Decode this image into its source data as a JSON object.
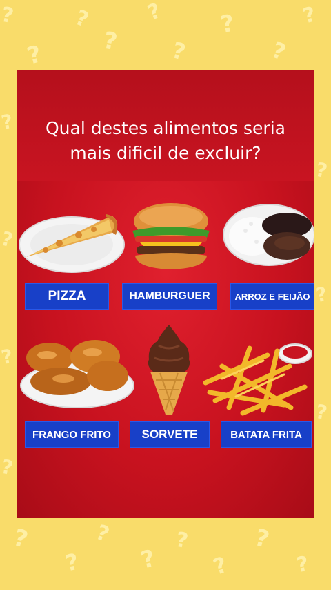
{
  "question": {
    "line1": "Qual destes alimentos seria",
    "line2": "mais dificil de excluir?"
  },
  "options": [
    {
      "label": "PIZZA",
      "icon": "pizza-icon"
    },
    {
      "label": "HAMBURGUER",
      "icon": "hamburger-icon"
    },
    {
      "label": "ARROZ E FEIJÃO",
      "icon": "rice-beans-icon"
    },
    {
      "label": "FRANGO FRITO",
      "icon": "fried-chicken-icon"
    },
    {
      "label": "SORVETE",
      "icon": "ice-cream-icon"
    },
    {
      "label": "BATATA FRITA",
      "icon": "french-fries-icon"
    }
  ],
  "colors": {
    "background": "#f9dc6a",
    "card": "#c8121f",
    "label": "#1840c8"
  }
}
